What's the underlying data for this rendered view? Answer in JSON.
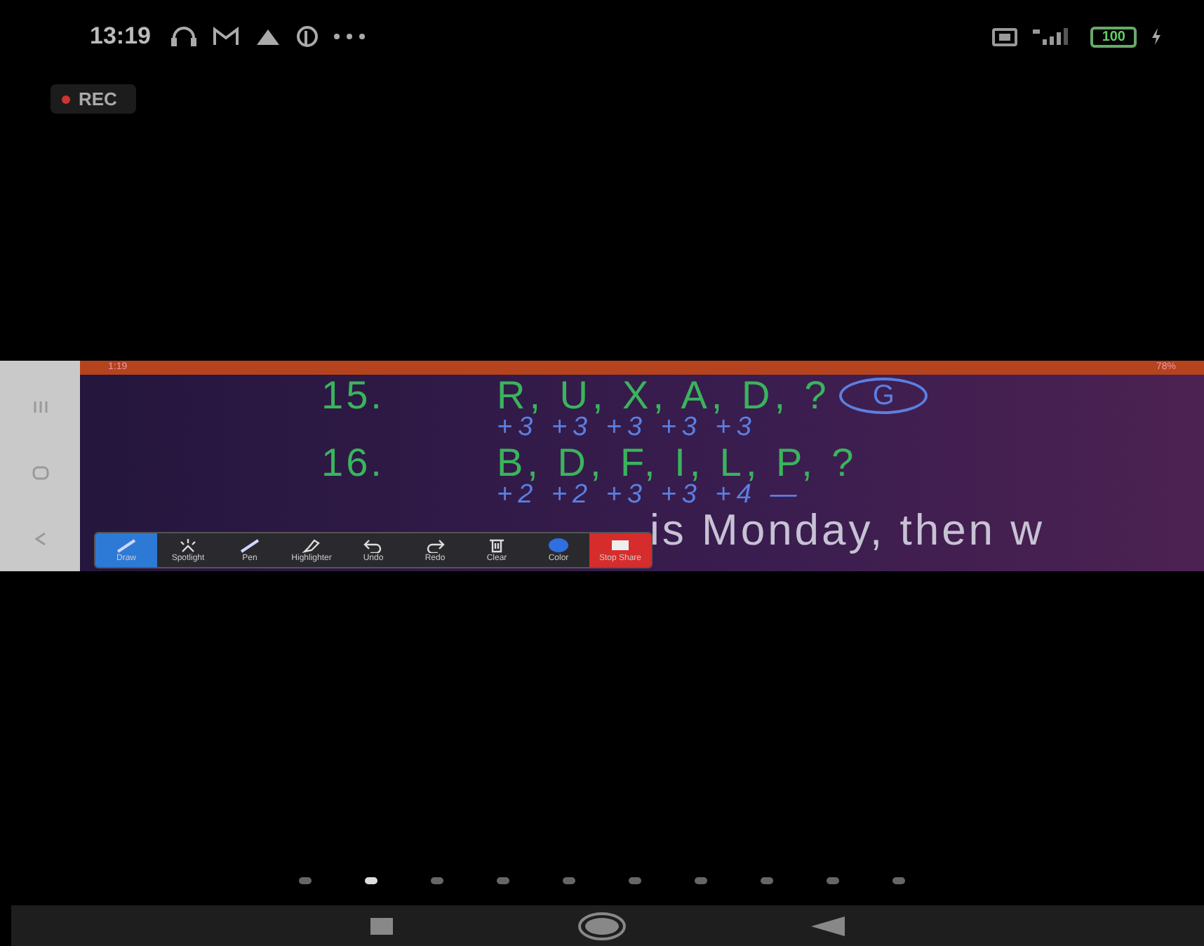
{
  "status_bar": {
    "time": "13:19",
    "battery": "100"
  },
  "recording": {
    "label": "REC"
  },
  "shared_screen": {
    "status_bar": {
      "time": "1:19",
      "battery": "78%"
    },
    "questions": [
      {
        "number": "15.",
        "sequence": "R, U, X, A, D, ?",
        "steps": "+3 +3 +3 +3 +3",
        "answer": "G"
      },
      {
        "number": "16.",
        "sequence": "B, D, F, I, L, P, ?",
        "steps": "+2 +2 +3 +3 +4 —"
      }
    ],
    "next_question": "is Monday, then w"
  },
  "annotation_toolbar": [
    {
      "label": "Draw",
      "kind": "draw",
      "selected": true
    },
    {
      "label": "Spotlight",
      "kind": "spotlight",
      "selected": false
    },
    {
      "label": "Pen",
      "kind": "pen",
      "selected": false
    },
    {
      "label": "Highlighter",
      "kind": "highlighter",
      "selected": false
    },
    {
      "label": "Undo",
      "kind": "undo",
      "selected": false
    },
    {
      "label": "Redo",
      "kind": "redo",
      "selected": false
    },
    {
      "label": "Clear",
      "kind": "clear",
      "selected": false
    },
    {
      "label": "Color",
      "kind": "color",
      "selected": false
    },
    {
      "label": "Stop Share",
      "kind": "stop",
      "selected": false
    }
  ],
  "page_dots": [
    {
      "selected": false
    },
    {
      "selected": true
    },
    {
      "selected": false
    },
    {
      "selected": false
    },
    {
      "selected": false
    },
    {
      "selected": false
    },
    {
      "selected": false
    },
    {
      "selected": false
    },
    {
      "selected": false
    },
    {
      "selected": false
    }
  ]
}
